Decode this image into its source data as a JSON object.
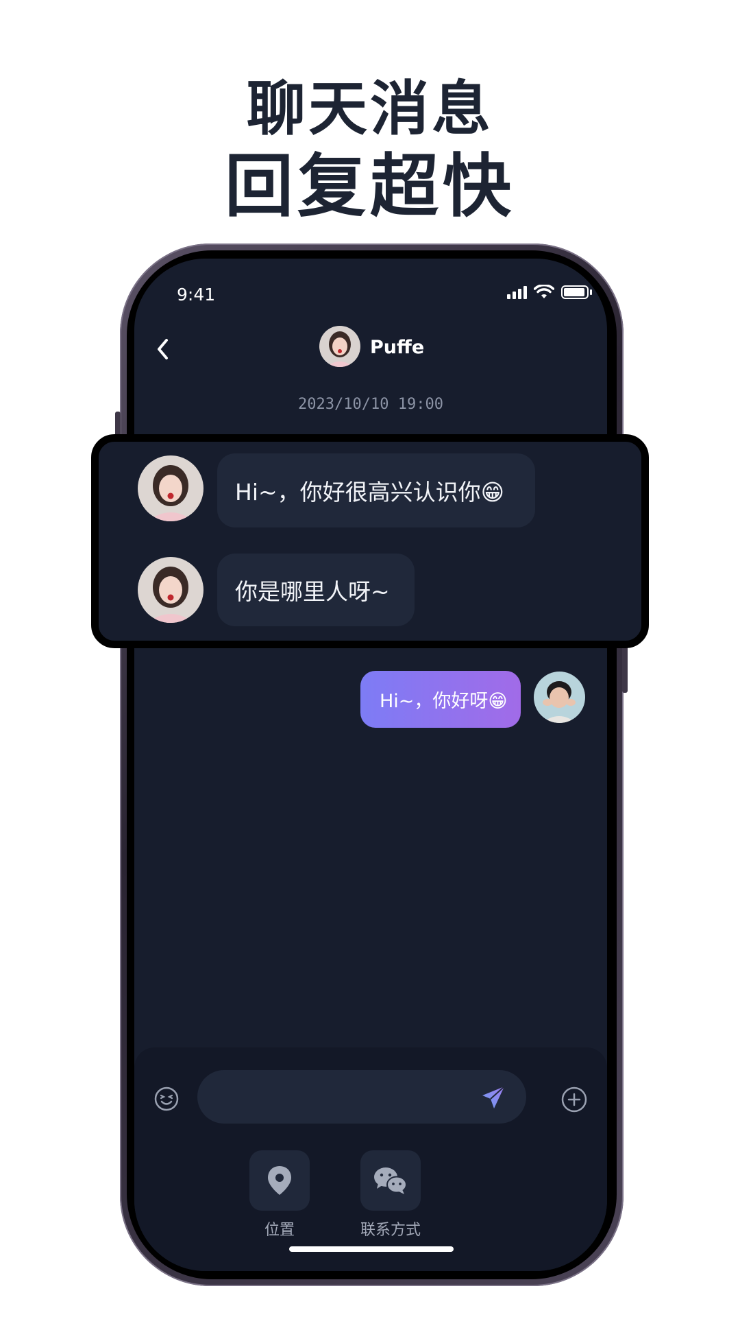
{
  "headline": {
    "line1": "聊天消息",
    "line2": "回复超快"
  },
  "status_bar": {
    "time": "9:41",
    "icons": [
      "signal-icon",
      "wifi-icon",
      "battery-icon"
    ]
  },
  "header": {
    "back_icon": "chevron-left-icon",
    "contact_name": "Puffe"
  },
  "timestamp": "2023/10/10  19:00",
  "messages": [
    {
      "from": "contact",
      "text": "Hi~，你好很高兴认识你😁"
    },
    {
      "from": "contact",
      "text": "你是哪里人呀~"
    },
    {
      "from": "me",
      "text": "Hi~，你好呀😁"
    }
  ],
  "composer": {
    "emoji_icon": "emoji-icon",
    "send_icon": "send-icon",
    "plus_icon": "plus-icon",
    "tools": [
      {
        "icon": "location-icon",
        "label": "位置"
      },
      {
        "icon": "wechat-icon",
        "label": "联系方式"
      }
    ]
  },
  "colors": {
    "screen_bg": "#171d2d",
    "bubble_in": "#20283a",
    "bubble_out_start": "#7d7cf5",
    "bubble_out_end": "#a16be8",
    "headline": "#1d2433"
  }
}
